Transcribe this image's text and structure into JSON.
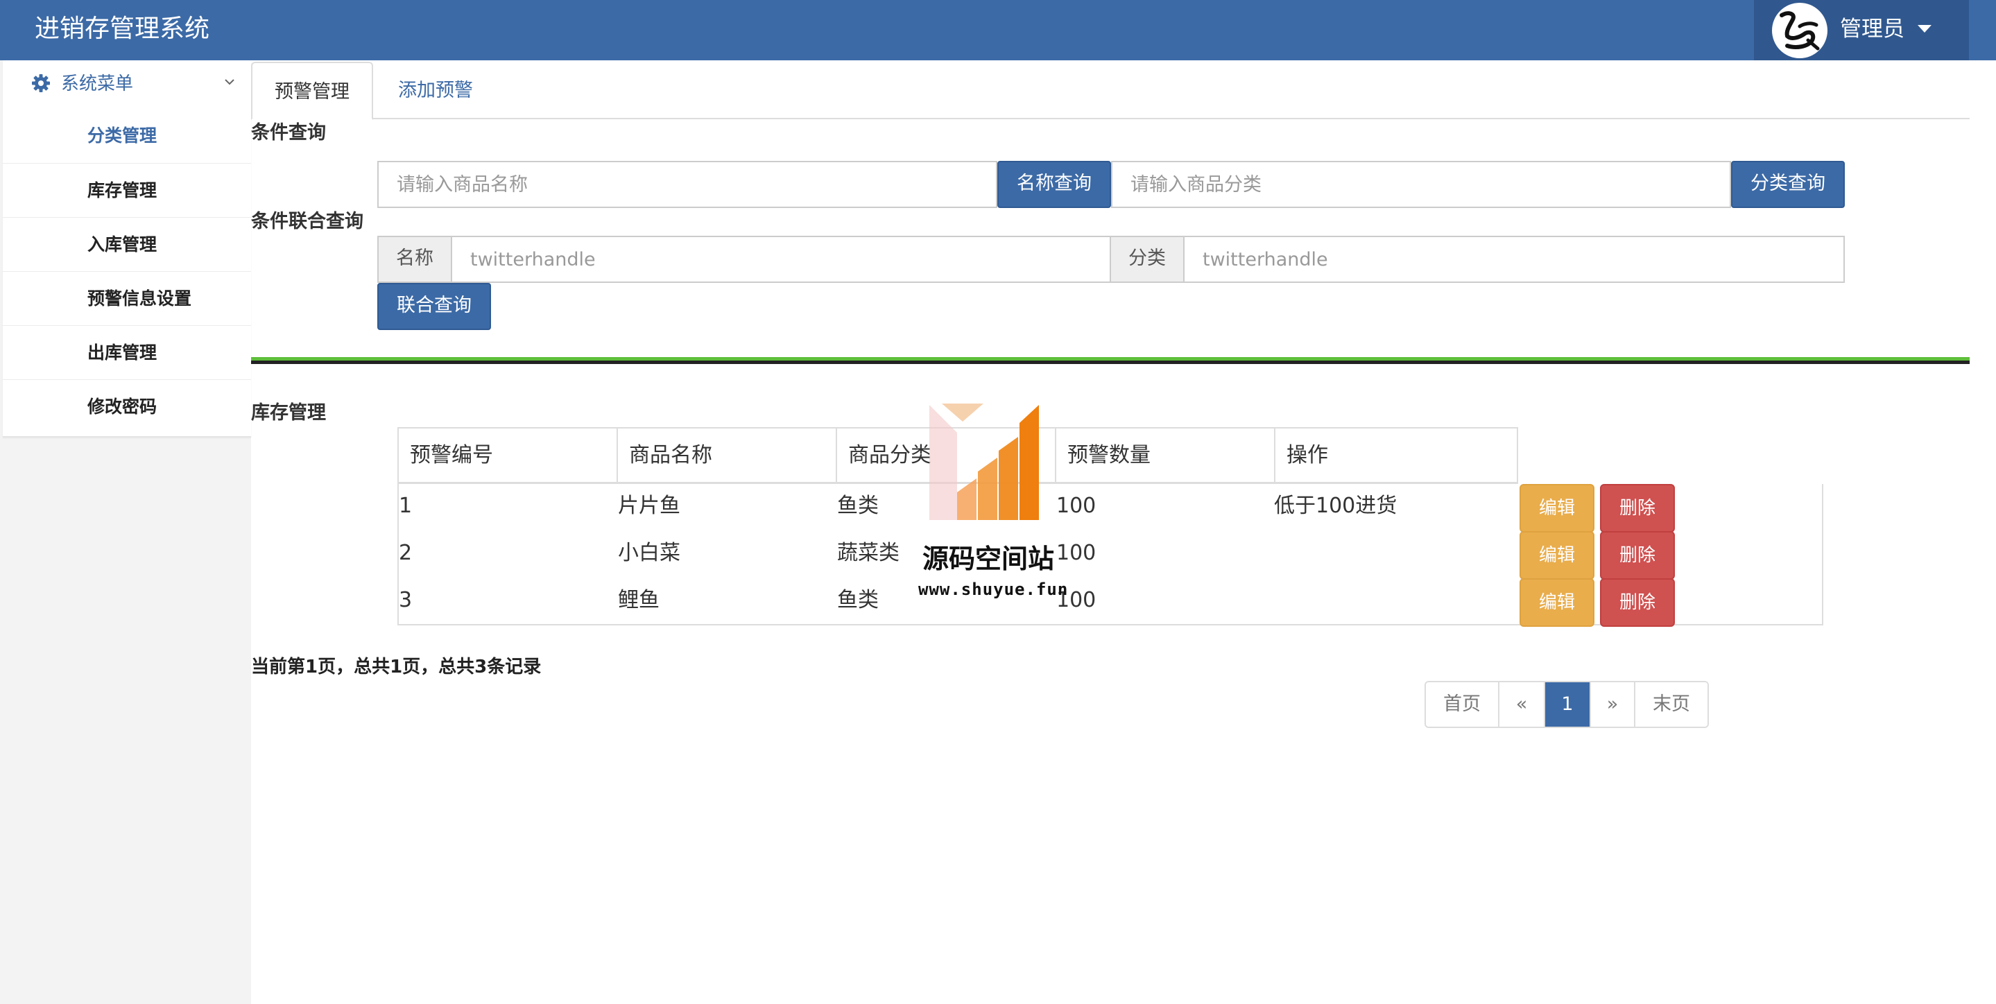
{
  "header": {
    "title": "进销存管理系统",
    "user_name": "管理员"
  },
  "sidebar": {
    "header_label": "系统菜单",
    "items": [
      {
        "label": "分类管理"
      },
      {
        "label": "库存管理"
      },
      {
        "label": "入库管理"
      },
      {
        "label": "预警信息设置"
      },
      {
        "label": "出库管理"
      },
      {
        "label": "修改密码"
      }
    ]
  },
  "tabs": [
    {
      "label": "预警管理"
    },
    {
      "label": "添加预警"
    }
  ],
  "query": {
    "section_label": "条件查询",
    "name_placeholder": "请输入商品名称",
    "name_button": "名称查询",
    "category_placeholder": "请输入商品分类",
    "category_button": "分类查询"
  },
  "joint_query": {
    "section_label": "条件联合查询",
    "name_addon": "名称",
    "name_placeholder": "twitterhandle",
    "category_addon": "分类",
    "category_placeholder": "twitterhandle",
    "button": "联合查询"
  },
  "table": {
    "section_label": "库存管理",
    "columns": [
      "预警编号",
      "商品名称",
      "商品分类",
      "预警数量",
      "操作"
    ],
    "rows": [
      {
        "id": "1",
        "name": "片片鱼",
        "category": "鱼类",
        "quantity": "100",
        "note": "低于100进货"
      },
      {
        "id": "2",
        "name": "小白菜",
        "category": "蔬菜类",
        "quantity": "100",
        "note": ""
      },
      {
        "id": "3",
        "name": "鲤鱼",
        "category": "鱼类",
        "quantity": "100",
        "note": ""
      }
    ],
    "edit_label": "编辑",
    "delete_label": "删除"
  },
  "paging": {
    "info": "当前第1页，总共1页，总共3条记录",
    "first": "首页",
    "prev": "«",
    "current": "1",
    "next": "»",
    "last": "末页"
  },
  "watermark": {
    "text": "源码空间站",
    "url": "www.shuyue.fun"
  },
  "colors": {
    "primary": "#3c6aa6",
    "warning": "#e9ad4c",
    "danger": "#cf5150",
    "divider_green": "#5ebe3a"
  }
}
